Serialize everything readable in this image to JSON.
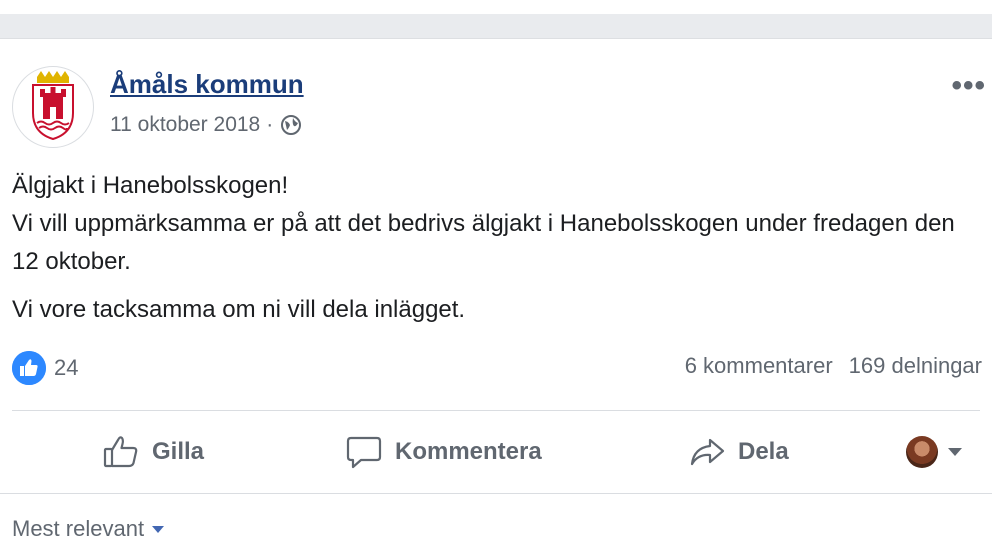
{
  "post": {
    "page_name": "Åmåls kommun",
    "date": "11 oktober 2018",
    "separator": "·",
    "audience_icon": "globe-icon",
    "more_icon": "more-options-icon",
    "more_label": "•••",
    "text": {
      "line1": "Älgjakt i Hanebolsskogen!",
      "line2": "Vi vill uppmärksamma er på att det bedrivs älgjakt i Hanebolsskogen under fredagen den 12 oktober.",
      "line3": "Vi vore tacksamma om ni vill dela inlägget."
    }
  },
  "stats": {
    "reaction_icon": "like-reaction-icon",
    "reactions_count": "24",
    "comments": "6 kommentarer",
    "shares": "169 delningar"
  },
  "actions": {
    "like": "Gilla",
    "comment": "Kommentera",
    "share": "Dela"
  },
  "comments": {
    "sort_label": "Mest relevant"
  },
  "colors": {
    "page_name": "#1b3d7a",
    "secondary_text": "#606770",
    "like_blue": "#2d88ff",
    "coat_of_arms_red": "#c8102e",
    "coat_of_arms_gold": "#e0b400"
  }
}
